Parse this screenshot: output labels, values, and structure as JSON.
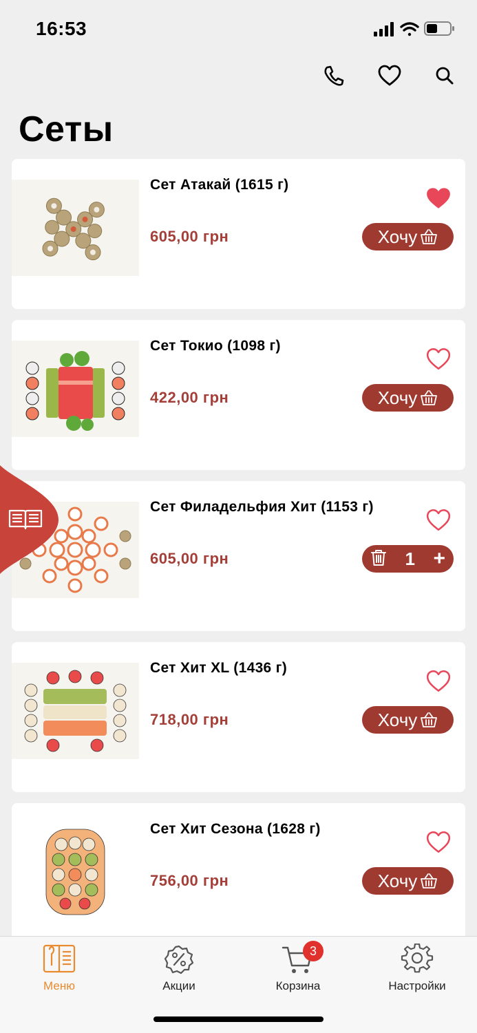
{
  "status": {
    "time": "16:53"
  },
  "page_title": "Сеты",
  "header_icons": [
    "phone-icon",
    "heart-icon",
    "search-icon"
  ],
  "colors": {
    "accent": "#9e3a30",
    "price": "#a33f38",
    "fav": "#e8475a",
    "tab_active": "#e88a2d",
    "badge": "#e0312c"
  },
  "products": [
    {
      "title": "Сет Атакай (1615 г)",
      "price": "605,00 грн",
      "favorite": true,
      "button_label": "Хочу",
      "in_cart": false
    },
    {
      "title": "Сет Токио (1098 г)",
      "price": "422,00 грн",
      "favorite": false,
      "button_label": "Хочу",
      "in_cart": false
    },
    {
      "title": "Сет Филадельфия Хит (1153 г)",
      "price": "605,00 грн",
      "favorite": false,
      "in_cart": true,
      "quantity": "1"
    },
    {
      "title": "Сет Хит XL (1436 г)",
      "price": "718,00 грн",
      "favorite": false,
      "button_label": "Хочу",
      "in_cart": false
    },
    {
      "title": "Сет Хит Сезона (1628 г)",
      "price": "756,00 грн",
      "favorite": false,
      "button_label": "Хочу",
      "in_cart": false
    }
  ],
  "tabbar": {
    "items": [
      {
        "label": "Меню",
        "icon": "menu-book-icon",
        "active": true
      },
      {
        "label": "Акции",
        "icon": "discount-icon",
        "active": false
      },
      {
        "label": "Корзина",
        "icon": "cart-icon",
        "active": false,
        "badge": "3"
      },
      {
        "label": "Настройки",
        "icon": "gear-icon",
        "active": false
      }
    ]
  }
}
